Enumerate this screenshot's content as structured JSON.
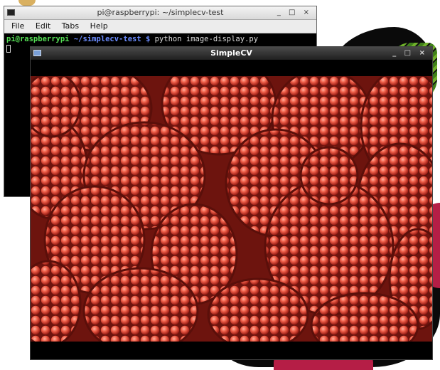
{
  "desktop": {
    "colors": {
      "leaf_green": "#6fb12b",
      "berry_red": "#b51e46",
      "logo_black": "#0a0a0a"
    }
  },
  "terminal": {
    "title": "pi@raspberrypi: ~/simplecv-test",
    "controls": "_ □ ×",
    "menu": [
      "File",
      "Edit",
      "Tabs",
      "Help"
    ],
    "prompt_user": "pi@raspberrypi",
    "prompt_path": " ~/simplecv-test $",
    "command": " python image-display.py"
  },
  "simplecv": {
    "title": "SimpleCV",
    "controls": "_ □ ×",
    "image_subject": "raspberries-photo"
  }
}
